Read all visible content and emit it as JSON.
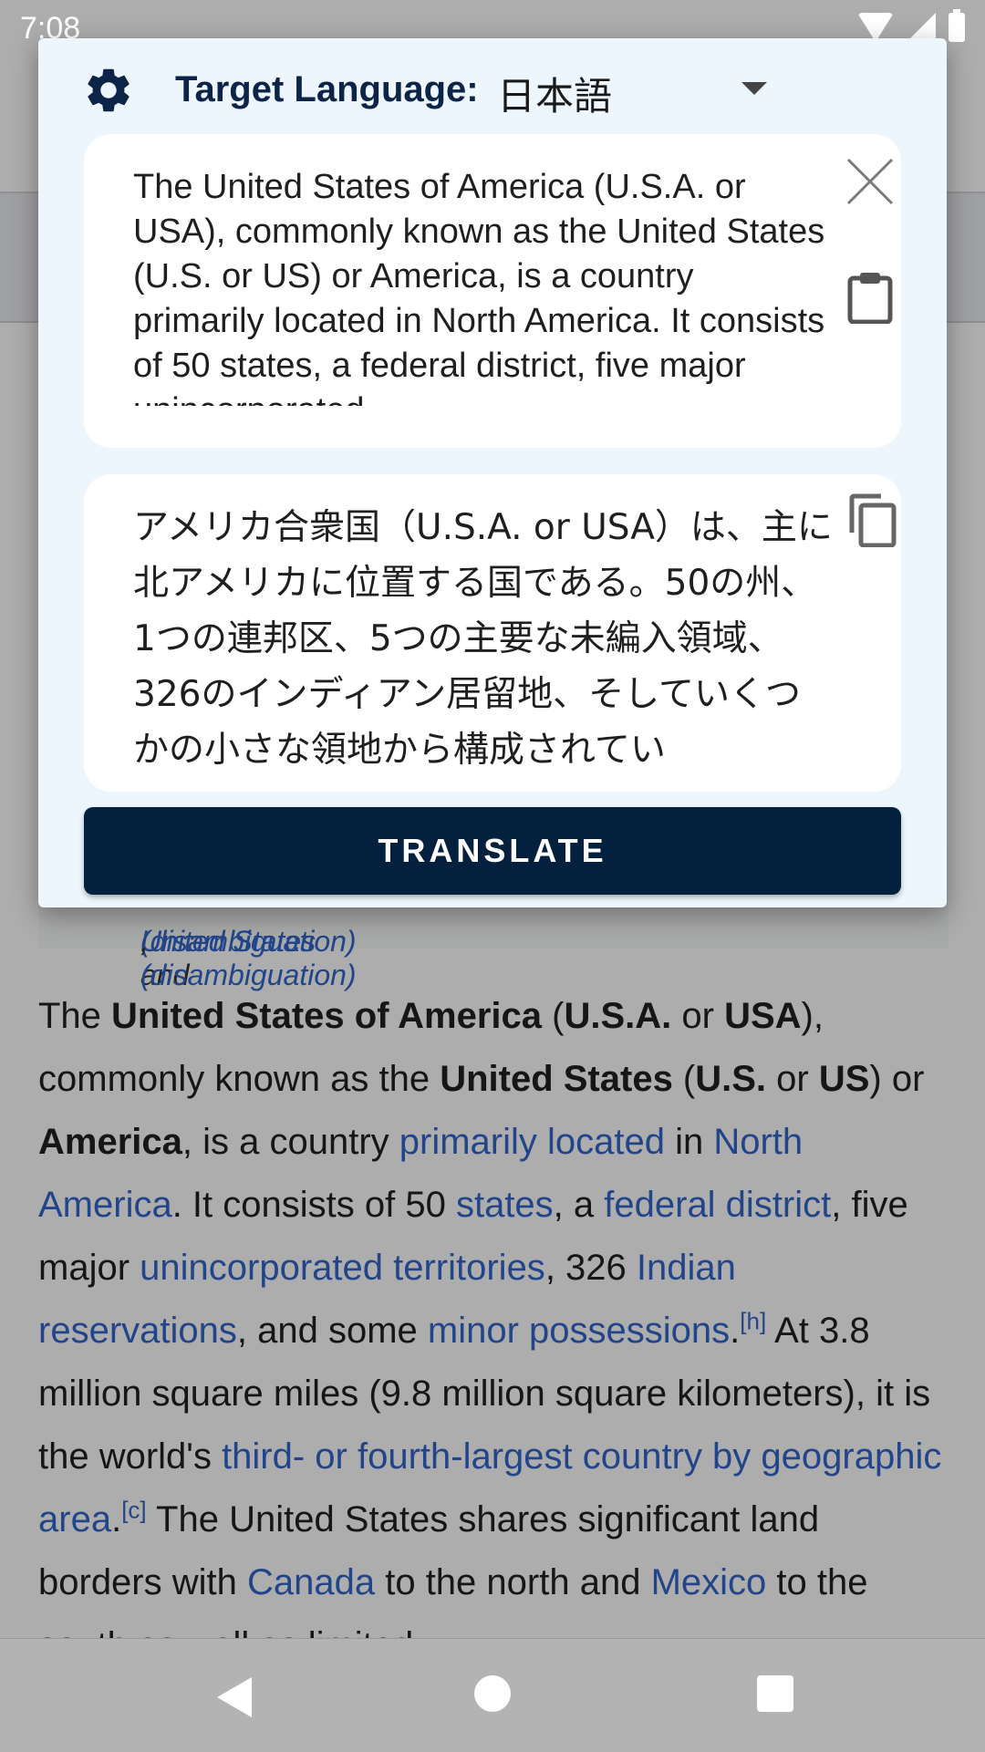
{
  "status_bar": {
    "time": "7:08"
  },
  "dialog": {
    "target_label": "Target Language:",
    "target_value": "日本語",
    "source_text": "The United States of America (U.S.A. or USA), commonly known as the United States (U.S. or US) or America, is a country primarily located in North America. It consists of 50 states, a federal district, five major unincorporated",
    "result_text": "アメリカ合衆国（U.S.A. or USA）は、主に北アメリカに位置する国である。50の州、1つの連邦区、5つの主要な未編入領域、326のインディアン居留地、そしていくつかの小さな領地から構成されてい",
    "translate_label": "TRANSLATE"
  },
  "background": {
    "hatnote": {
      "part1": "(disambiguation)",
      "part2": ", and ",
      "part3": "United States (disambiguation)",
      "part4": "."
    },
    "article": {
      "s1": "The ",
      "b1": "United States of America",
      "s2": " (",
      "b2": "U.S.A.",
      "s3": " or ",
      "b3": "USA",
      "s4": "), commonly known as the ",
      "b4": "United States",
      "s5": " (",
      "b5": "U.S.",
      "s6": " or ",
      "b6": "US",
      "s7": ") or ",
      "b7": "America",
      "s8": ", is a country ",
      "l1": "primarily located",
      "s9": " in ",
      "l2": "North America",
      "s10": ". It consists of 50 ",
      "l3": "states",
      "s11": ", a ",
      "l4": "federal district",
      "s12": ", five major ",
      "l5": "unincorporated territories",
      "s13": ", 326 ",
      "l6": "Indian reservations",
      "s14": ", and some ",
      "l7": "minor possessions",
      "s15": ".",
      "sup1": "[h]",
      "s16": " At 3.8 million square miles (9.8 million square kilometers), it is the world's ",
      "l8": "third- or fourth-largest country by geographic area",
      "s17": ".",
      "sup2": "[c]",
      "s18": " The United States shares significant land borders with ",
      "l9": "Canada",
      "s19": " to the north and ",
      "l10": "Mexico",
      "s20": " to the south as well as limited"
    }
  },
  "colors": {
    "dialog_bg": "#eef6fd",
    "accent_dark_navy": "#04203f",
    "link": "#3366cc"
  },
  "icons": {
    "settings": "gear-icon",
    "dropdown": "dropdown-arrow-icon",
    "clear": "close-icon",
    "paste": "clipboard-icon",
    "copy": "copy-icon",
    "nav_back": "back-icon",
    "nav_home": "home-icon",
    "nav_recents": "recents-icon"
  }
}
